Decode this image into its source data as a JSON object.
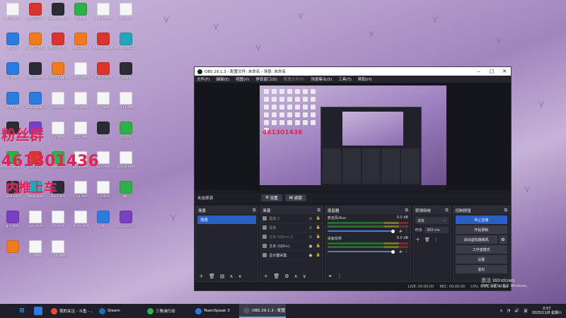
{
  "desktop": {
    "icons": [
      {
        "label": "Administr...",
        "color": "file"
      },
      {
        "label": "网易云音乐",
        "color": "red"
      },
      {
        "label": "jujuwo 收藏夹",
        "color": "dark"
      },
      {
        "label": "KOOK",
        "color": "green"
      },
      {
        "label": "g001.dem",
        "color": "file"
      },
      {
        "label": "10.dem",
        "color": "file"
      },
      {
        "label": "此电脑",
        "color": "blue"
      },
      {
        "label": "英雄联盟 WeGame版",
        "color": "orange"
      },
      {
        "label": "DNF 区域 WeGame版",
        "color": "red"
      },
      {
        "label": "WeGame",
        "color": "orange"
      },
      {
        "label": "Adobe 虚拟机",
        "color": "red"
      },
      {
        "label": "Microsoft Edge",
        "color": "teal"
      },
      {
        "label": "回收站",
        "color": "blue"
      },
      {
        "label": "OBS Studio",
        "color": "dark"
      },
      {
        "label": "Cheat Engine",
        "color": "orange"
      },
      {
        "label": "10-15.dem",
        "color": "file"
      },
      {
        "label": "LOL 1.dem",
        "color": "red"
      },
      {
        "label": "Zenpt",
        "color": "dark"
      },
      {
        "label": "控制面板",
        "color": "blue"
      },
      {
        "label": "TeamSpeak 3",
        "color": "blue"
      },
      {
        "label": "3 Unicorn",
        "color": "file"
      },
      {
        "label": "6-15dem",
        "color": "file"
      },
      {
        "label": "5-7.dem",
        "color": "file"
      },
      {
        "label": "10-17.dem",
        "color": "file"
      },
      {
        "label": "Steam",
        "color": "dark"
      },
      {
        "label": "Steam",
        "color": "purple"
      },
      {
        "label": "7-7.dem",
        "color": "file"
      },
      {
        "label": "1-15.dem",
        "color": "file"
      },
      {
        "label": "CS GO",
        "color": "dark"
      },
      {
        "label": "QQ音乐",
        "color": "green"
      },
      {
        "label": "Razer Synapse",
        "color": "green"
      },
      {
        "label": "Core Temp",
        "color": "red"
      },
      {
        "label": "uTorrent",
        "color": "green"
      },
      {
        "label": "g001.dem",
        "color": "file"
      },
      {
        "label": "123.dem",
        "color": "file"
      },
      {
        "label": "g001d.dem",
        "color": "file"
      },
      {
        "label": "GoDi Sens",
        "color": "dark"
      },
      {
        "label": "Wallpaper",
        "color": "teal"
      },
      {
        "label": "2021 Win",
        "color": "dark"
      },
      {
        "label": "1-12.dem",
        "color": "file"
      },
      {
        "label": "1-2.dem",
        "color": "file"
      },
      {
        "label": "微信",
        "color": "green"
      },
      {
        "label": "g-1.dem",
        "color": "purple"
      },
      {
        "label": "g16.dem",
        "color": "file"
      },
      {
        "label": "5-6.dem",
        "color": "file"
      },
      {
        "label": "16-15.dem",
        "color": "file"
      },
      {
        "label": "QQ",
        "color": "blue"
      },
      {
        "label": "2021 11-15",
        "color": "purple"
      },
      {
        "label": "EA",
        "color": "orange"
      },
      {
        "label": "5-3.dem",
        "color": "file"
      },
      {
        "label": "7-16.dem",
        "color": "file"
      }
    ],
    "overlay_line1": "粉丝群",
    "overlay_line2": "461301436",
    "overlay_line3": "内推上车"
  },
  "obs": {
    "title": "OBS 29.1.3 - 配置文件: 未命名 - 场景: 未命名",
    "menu": [
      "文件(F)",
      "编辑(E)",
      "视图(V)",
      "停靠窗口(D)",
      "配置文件(P)",
      "场景集合(S)",
      "工具(T)",
      "帮助(H)"
    ],
    "preview_text": "461301436",
    "no_source_selected": "未选择源",
    "props_button": "设置",
    "filters_button": "滤镜",
    "docks": {
      "scenes": {
        "title": "场景",
        "items": [
          "场景"
        ]
      },
      "sources": {
        "title": "来源",
        "items": [
          {
            "label": "图像 2",
            "visible": false
          },
          {
            "label": "图像",
            "visible": false
          },
          {
            "label": "文本 (GDI+) 2",
            "visible": false
          },
          {
            "label": "文本 (GDI+)",
            "visible": true
          },
          {
            "label": "显示器采集",
            "visible": true
          }
        ]
      },
      "mixer": {
        "title": "混音器",
        "channels": [
          {
            "name": "麦克风/Aux",
            "db": "0.0 dB"
          },
          {
            "name": "桌面音频",
            "db": "0.0 dB"
          }
        ]
      },
      "transitions": {
        "title": "转场特效",
        "type": "渐变",
        "duration_label": "时长",
        "duration_value": "300 ms"
      },
      "controls": {
        "title": "控制按钮",
        "buttons": [
          "停止直播",
          "开始录制",
          "启动虚拟摄像机",
          "工作室模式",
          "设置",
          "退出"
        ]
      }
    },
    "status": {
      "live": "LIVE: 00:00:00",
      "rec": "REC: 00:00:00",
      "cpu": "CPU: 0.5%, 30.00 fps"
    }
  },
  "watermark": {
    "line1": "激活 Windows",
    "line2": "转到\"设置\"以激活 Windows。"
  },
  "taskbar": {
    "items": [
      {
        "label": "我的关注 - 斗鱼 - ...",
        "color": "#e84b3c",
        "active": false
      },
      {
        "label": "Steam",
        "color": "#1b6fb0",
        "active": false
      },
      {
        "label": "三角洲行动",
        "color": "#2fb04a",
        "active": false
      },
      {
        "label": "TeamSpeak 3",
        "color": "#2d7be0",
        "active": false
      },
      {
        "label": "OBS 29.1.3 - 配置...",
        "color": "#555566",
        "active": true
      }
    ],
    "tray_lang": "英",
    "time": "0:57",
    "date": "2025/11/8 星期六"
  }
}
